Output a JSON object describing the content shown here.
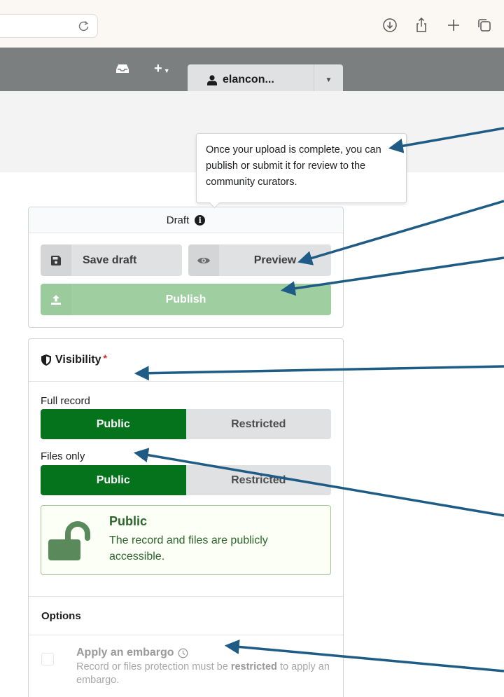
{
  "header": {
    "user_name": "elancon..."
  },
  "tooltip": {
    "text": "Once your upload is complete, you can publish or submit it for review to the community curators."
  },
  "draft_card": {
    "status": "Draft",
    "save_label": "Save draft",
    "preview_label": "Preview",
    "publish_label": "Publish"
  },
  "visibility": {
    "title": "Visibility",
    "required_marker": "*",
    "full_record": {
      "label": "Full record",
      "options": [
        "Public",
        "Restricted"
      ],
      "selected": "Public"
    },
    "files_only": {
      "label": "Files only",
      "options": [
        "Public",
        "Restricted"
      ],
      "selected": "Public"
    },
    "message": {
      "title": "Public",
      "body": "The record and files are publicly accessible."
    },
    "options_title": "Options",
    "embargo": {
      "label": "Apply an embargo",
      "help_prefix": "Record or files protection must be ",
      "help_bold": "restricted",
      "help_suffix": " to apply an embargo."
    }
  },
  "colors": {
    "header_bg": "#7b7f80",
    "toggle_on": "#05731c",
    "publish_bg": "#9fcfa1",
    "annotation_arrow": "#1f5c85",
    "message_text": "#2c662d"
  },
  "icons": {
    "reload": "reload-icon",
    "download": "download-icon",
    "share": "share-icon",
    "new_tab": "plus-icon",
    "tabs": "tabs-icon",
    "inbox": "inbox-icon",
    "user": "user-icon",
    "save": "save-icon",
    "preview": "eye-icon",
    "publish": "upload-icon",
    "visibility": "shield-icon",
    "message": "unlock-icon",
    "embargo": "clock-icon"
  }
}
